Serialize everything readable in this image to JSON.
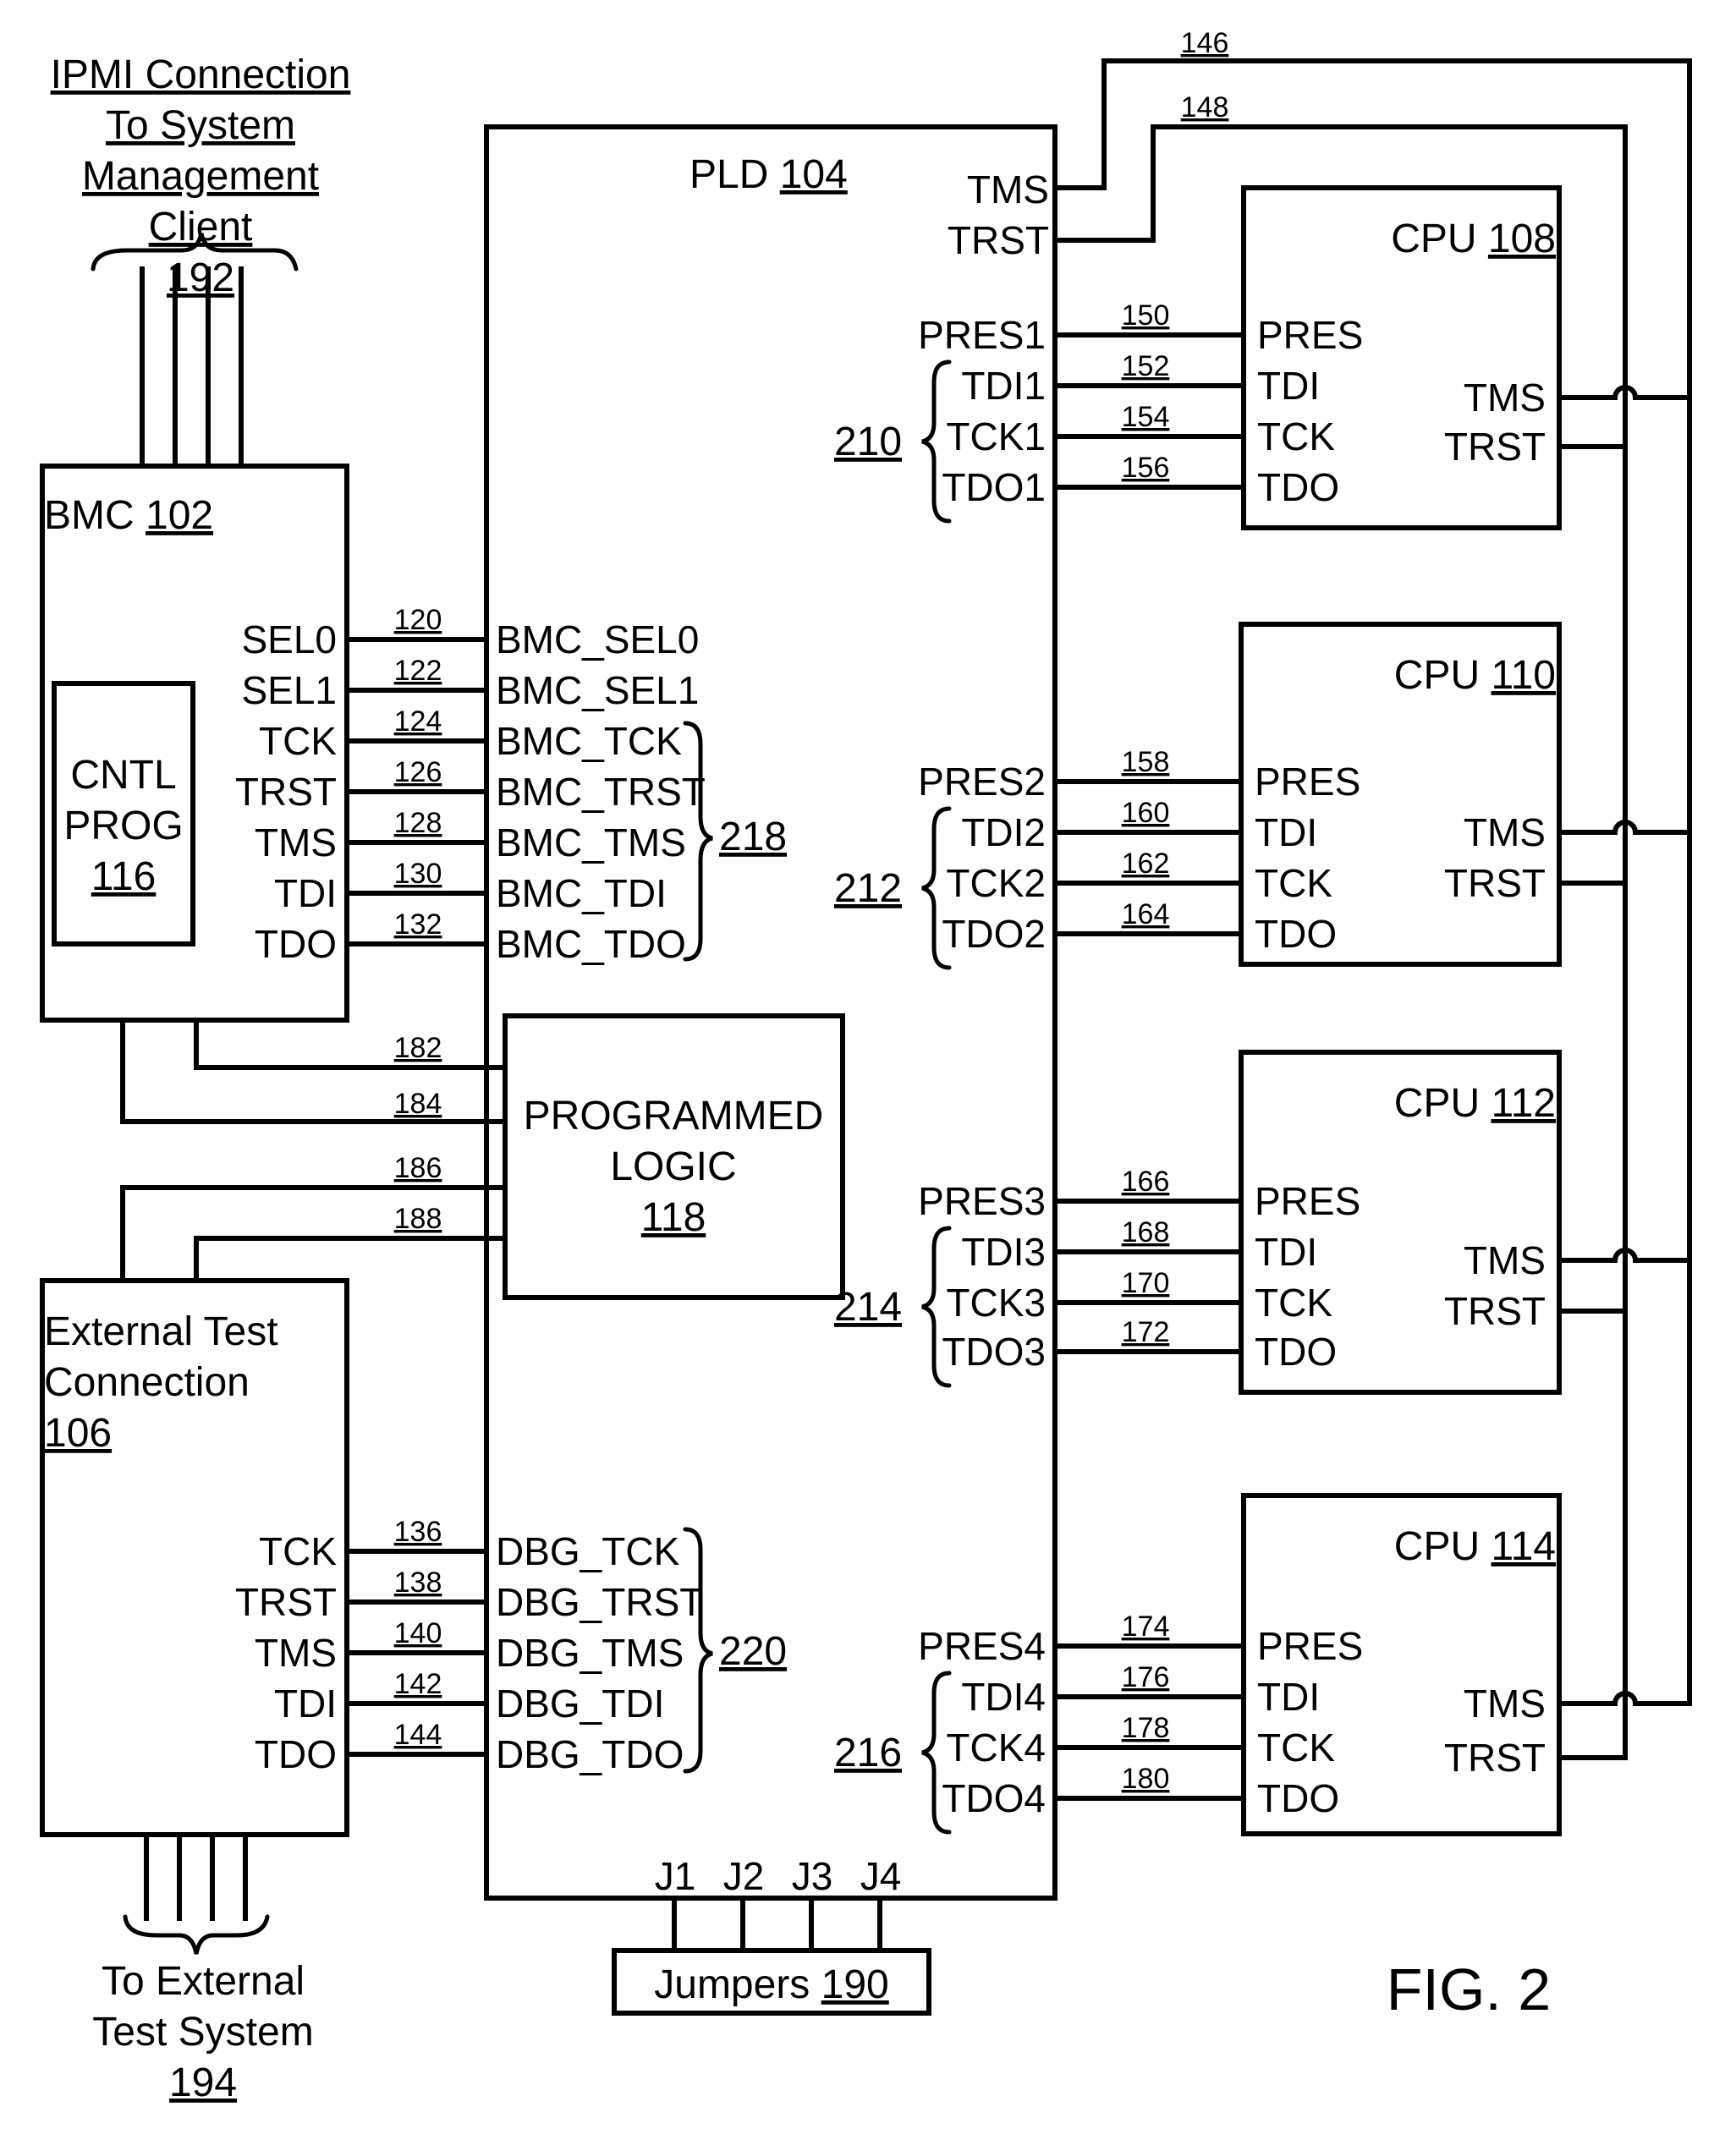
{
  "figure_label": "FIG. 2",
  "ipmi": {
    "lines": [
      "IPMI Connection",
      "To System",
      "Management",
      "Client"
    ],
    "ref": "192"
  },
  "external_system": {
    "lines": [
      "To External",
      "Test System"
    ],
    "ref": "194"
  },
  "bmc": {
    "name": "BMC",
    "ref": "102",
    "cntl": {
      "lines": [
        "CNTL",
        "PROG"
      ],
      "ref": "116"
    },
    "pins": [
      "SEL0",
      "SEL1",
      "TCK",
      "TRST",
      "TMS",
      "TDI",
      "TDO"
    ]
  },
  "bmc_wires": [
    "120",
    "122",
    "124",
    "126",
    "128",
    "130",
    "132"
  ],
  "pld": {
    "name": "PLD",
    "ref": "104",
    "bmc_pins": [
      "BMC_SEL0",
      "BMC_SEL1",
      "BMC_TCK",
      "BMC_TRST",
      "BMC_TMS",
      "BMC_TDI",
      "BMC_TDO"
    ],
    "bmc_group_ref": "218",
    "dbg_pins": [
      "DBG_TCK",
      "DBG_TRST",
      "DBG_TMS",
      "DBG_TDI",
      "DBG_TDO"
    ],
    "dbg_group_ref": "220",
    "top_pins": [
      "TMS",
      "TRST"
    ],
    "jumper_pins": [
      "J1",
      "J2",
      "J3",
      "J4"
    ]
  },
  "programmed_logic": {
    "lines": [
      "PROGRAMMED",
      "LOGIC"
    ],
    "ref": "118"
  },
  "logic_wires": [
    "182",
    "184",
    "186",
    "188"
  ],
  "ext_test": {
    "lines": [
      "External Test",
      "Connection"
    ],
    "ref": "106",
    "pins": [
      "TCK",
      "TRST",
      "TMS",
      "TDI",
      "TDO"
    ]
  },
  "dbg_wires": [
    "136",
    "138",
    "140",
    "142",
    "144"
  ],
  "jumpers": {
    "name": "Jumpers",
    "ref": "190"
  },
  "chain_wires": [
    "146",
    "148"
  ],
  "cpus": [
    {
      "name": "CPU",
      "ref": "108",
      "pld_pins": [
        "PRES1",
        "TDI1",
        "TCK1",
        "TDO1"
      ],
      "group_ref": "210",
      "wires": [
        "150",
        "152",
        "154",
        "156"
      ]
    },
    {
      "name": "CPU",
      "ref": "110",
      "pld_pins": [
        "PRES2",
        "TDI2",
        "TCK2",
        "TDO2"
      ],
      "group_ref": "212",
      "wires": [
        "158",
        "160",
        "162",
        "164"
      ]
    },
    {
      "name": "CPU",
      "ref": "112",
      "pld_pins": [
        "PRES3",
        "TDI3",
        "TCK3",
        "TDO3"
      ],
      "group_ref": "214",
      "wires": [
        "166",
        "168",
        "170",
        "172"
      ]
    },
    {
      "name": "CPU",
      "ref": "114",
      "pld_pins": [
        "PRES4",
        "TDI4",
        "TCK4",
        "TDO4"
      ],
      "group_ref": "216",
      "wires": [
        "174",
        "176",
        "178",
        "180"
      ]
    }
  ],
  "cpu_left_pins": [
    "PRES",
    "TDI",
    "TCK",
    "TDO"
  ],
  "cpu_right_pins": [
    "TMS",
    "TRST"
  ]
}
